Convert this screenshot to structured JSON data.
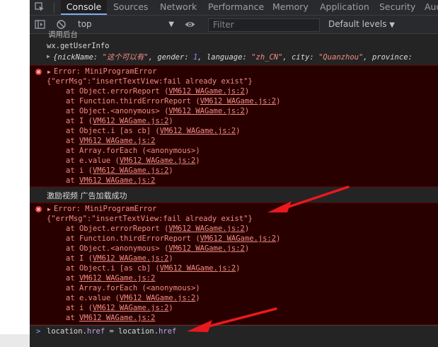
{
  "tabs": [
    "Console",
    "Sources",
    "Network",
    "Performance",
    "Memory",
    "Application",
    "Security",
    "Audits"
  ],
  "toolbar": {
    "context": "top",
    "filter_placeholder": "Filter",
    "levels": "Default levels"
  },
  "console": {
    "clipped_top_line": "wx.getUserInfo",
    "clipped_top_partial": "调用后台",
    "log1": "wx.getUserInfo",
    "object_preview": {
      "open": "{",
      "k1": "nickName",
      "v1": "\"这个可以有\"",
      "k2": "gender",
      "v2": "1",
      "k3": "language",
      "v3": "\"zh_CN\"",
      "k4": "city",
      "v4": "\"Quanzhou\"",
      "k5": "province",
      "v5": ":"
    },
    "error1": {
      "title": "Error: MiniProgramError",
      "msg": "{\"errMsg\":\"insertTextView:fail already exist\"}",
      "stack": [
        {
          "prefix": "at Object.errorReport (",
          "link": "VM612 WAGame.js:2",
          "suffix": ")"
        },
        {
          "prefix": "at Function.thirdErrorReport (",
          "link": "VM612 WAGame.js:2",
          "suffix": ")"
        },
        {
          "prefix": "at Object.<anonymous> (",
          "link": "VM612 WAGame.js:2",
          "suffix": ")"
        },
        {
          "prefix": "at I (",
          "link": "VM612 WAGame.js:2",
          "suffix": ")"
        },
        {
          "prefix": "at Object.i [as cb] (",
          "link": "VM612 WAGame.js:2",
          "suffix": ")"
        },
        {
          "prefix": "at ",
          "link": "VM612 WAGame.js:2",
          "suffix": ""
        },
        {
          "prefix": "at Array.forEach (<anonymous>)",
          "link": "",
          "suffix": ""
        },
        {
          "prefix": "at e.value (",
          "link": "VM612 WAGame.js:2",
          "suffix": ")"
        },
        {
          "prefix": "at i (",
          "link": "VM612 WAGame.js:2",
          "suffix": ")"
        },
        {
          "prefix": "at ",
          "link": "VM612 WAGame.js:2",
          "suffix": ""
        }
      ]
    },
    "log2": "激励视频 广告加载成功",
    "error2": {
      "title": "Error: MiniProgramError",
      "msg": "{\"errMsg\":\"insertTextView:fail already exist\"}",
      "stack": [
        {
          "prefix": "at Object.errorReport (",
          "link": "VM612 WAGame.js:2",
          "suffix": ")"
        },
        {
          "prefix": "at Function.thirdErrorReport (",
          "link": "VM612 WAGame.js:2",
          "suffix": ")"
        },
        {
          "prefix": "at Object.<anonymous> (",
          "link": "VM612 WAGame.js:2",
          "suffix": ")"
        },
        {
          "prefix": "at I (",
          "link": "VM612 WAGame.js:2",
          "suffix": ")"
        },
        {
          "prefix": "at Object.i [as cb] (",
          "link": "VM612 WAGame.js:2",
          "suffix": ")"
        },
        {
          "prefix": "at ",
          "link": "VM612 WAGame.js:2",
          "suffix": ""
        },
        {
          "prefix": "at Array.forEach (<anonymous>)",
          "link": "",
          "suffix": ""
        },
        {
          "prefix": "at e.value (",
          "link": "VM612 WAGame.js:2",
          "suffix": ")"
        },
        {
          "prefix": "at i (",
          "link": "VM612 WAGame.js:2",
          "suffix": ")"
        },
        {
          "prefix": "at ",
          "link": "VM612 WAGame.js:2",
          "suffix": ""
        }
      ]
    },
    "prompt_symbol": ">",
    "input": {
      "t1": "location",
      "t2": ".",
      "t3": "href",
      "t4": " = ",
      "t5": "location",
      "t6": ".",
      "t7": "href"
    }
  },
  "colors": {
    "arrow": "#e8191f",
    "error_text": "#f28b82",
    "error_bg": "#290000"
  }
}
